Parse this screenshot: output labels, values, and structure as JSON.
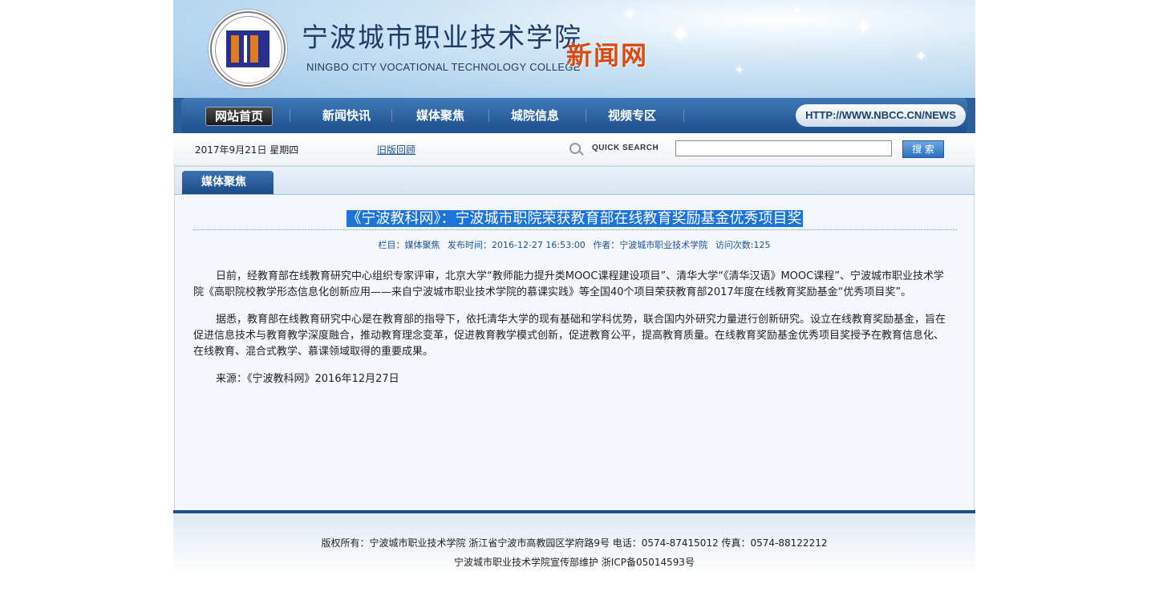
{
  "header": {
    "college_cn": "宁波城市职业技术学院",
    "college_en": "NINGBO CITY VOCATIONAL TECHNOLOGY COLLEGE",
    "site_name": "新闻网"
  },
  "nav": {
    "items": [
      {
        "label": "网站首页"
      },
      {
        "label": "新闻快讯"
      },
      {
        "label": "媒体聚焦"
      },
      {
        "label": "城院信息"
      },
      {
        "label": "视频专区"
      }
    ],
    "url": "HTTP://WWW.NBCC.CN/NEWS"
  },
  "infobar": {
    "date": "2017年9月21日 星期四",
    "old_version": "旧版回顾",
    "quick_search": "QUICK SEARCH",
    "search_value": "",
    "search_button": "搜 索"
  },
  "section": {
    "tab": "媒体聚焦"
  },
  "article": {
    "title": "《宁波教科网》：宁波城市职院荣获教育部在线教育奖励基金优秀项目奖",
    "meta": {
      "column": "栏目：媒体聚焦",
      "time": "发布时间：2016-12-27 16:53:00",
      "author": "作者：宁波城市职业技术学院",
      "visits": "访问次数:125"
    },
    "paragraphs": [
      "日前，经教育部在线教育研究中心组织专家评审，北京大学“教师能力提升类MOOC课程建设项目”、清华大学“《清华汉语》MOOC课程”、宁波城市职业技术学院《高职院校教学形态信息化创新应用——来自宁波城市职业技术学院的慕课实践》等全国40个项目荣获教育部2017年度在线教育奖励基金“优秀项目奖”。",
      "据悉，教育部在线教育研究中心是在教育部的指导下，依托清华大学的现有基础和学科优势，联合国内外研究力量进行创新研究。设立在线教育奖励基金，旨在促进信息技术与教育教学深度融合，推动教育理念变革，促进教育教学模式创新，促进教育公平，提高教育质量。在线教育奖励基金优秀项目奖授予在教育信息化、在线教育、混合式教学、慕课领域取得的重要成果。",
      "来源：《宁波教科网》2016年12月27日"
    ]
  },
  "footer": {
    "line1": "版权所有：宁波城市职业技术学院 浙江省宁波市高教园区学府路9号 电话：0574-87415012 传真：0574-88122212",
    "line2": "宁波城市职业技术学院宣传部维护 浙ICP备05014593号"
  }
}
